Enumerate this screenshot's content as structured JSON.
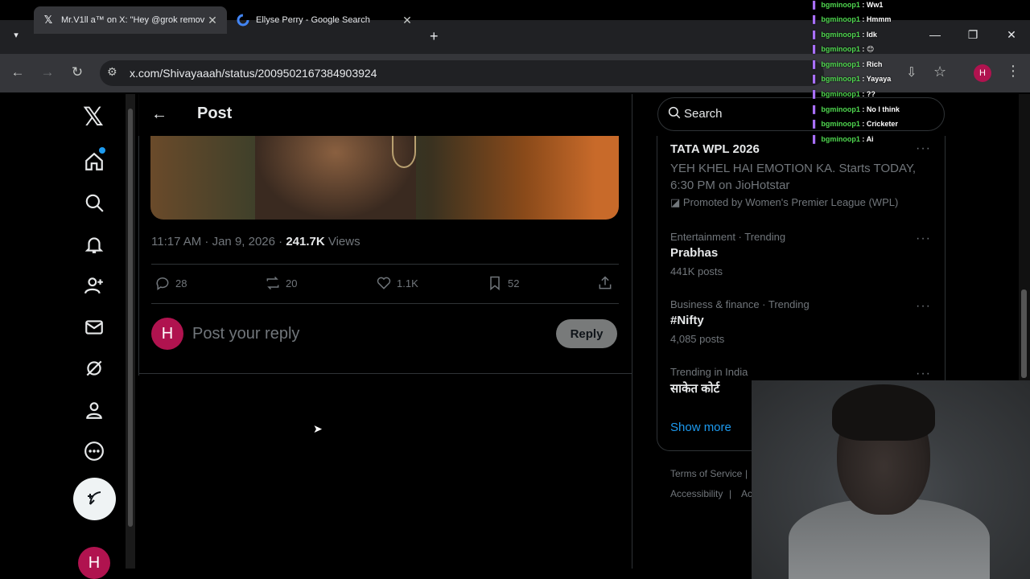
{
  "browser": {
    "tabs": [
      {
        "title": "Mr.V1ll a™ on X: \"Hey @grok remov",
        "favicon": "x-logo",
        "active": true
      },
      {
        "title": "Ellyse Perry - Google Search",
        "favicon": "google-g",
        "active": false
      }
    ],
    "new_tab": "+",
    "url": "x.com/Shivayaaah/status/2009502167384903924",
    "profile_initial": "H"
  },
  "x_nav": {
    "items": [
      "Home",
      "Explore",
      "Notifications",
      "Follow",
      "Messages",
      "Grok",
      "Profile",
      "More"
    ],
    "post_button": "Post",
    "avatar_initial": "H"
  },
  "post": {
    "header_title": "Post",
    "time": "11:17 AM · Jan 9, 2026 · ",
    "views_count": "241.7K",
    "views_label": " Views",
    "actions": {
      "replies": "28",
      "reposts": "20",
      "likes": "1.1K",
      "bookmarks": "52"
    },
    "reply_avatar": "H",
    "reply_placeholder": "Post your reply",
    "reply_button": "Reply"
  },
  "sidebar": {
    "search_placeholder": "Search",
    "promo": {
      "title": "TATA WPL 2026",
      "text": "YEH KHEL HAI EMOTION KA. Starts TODAY, 6:30 PM on JioHotstar",
      "by": "Promoted by Women's Premier League (WPL)"
    },
    "trends": [
      {
        "category": "Entertainment · Trending",
        "title": "Prabhas",
        "count": "441K posts"
      },
      {
        "category": "Business & finance · Trending",
        "title": "#Nifty",
        "count": "4,085 posts"
      },
      {
        "category": "Trending in India",
        "title": "साकेत कोर्ट",
        "count": ""
      }
    ],
    "more_icon": "···",
    "show_more": "Show more",
    "footer": [
      "Terms of Service",
      "|",
      "Accessibility",
      "|",
      "Ac"
    ]
  },
  "chat_overlay": [
    {
      "user": "bgminoop1",
      "message": "Ww1"
    },
    {
      "user": "bgminoop1",
      "message": "Hmmm"
    },
    {
      "user": "bgminoop1",
      "message": "Idk"
    },
    {
      "user": "bgminoop1",
      "message": "😊"
    },
    {
      "user": "bgminoop1",
      "message": "Rich"
    },
    {
      "user": "bgminoop1",
      "message": "Yayaya"
    },
    {
      "user": "bgminoop1",
      "message": "??"
    },
    {
      "user": "bgminoop1",
      "message": "No I think"
    },
    {
      "user": "bgminoop1",
      "message": "Cricketer"
    },
    {
      "user": "bgminoop1",
      "message": "Ai"
    }
  ],
  "colors": {
    "accent": "#1d9bf0",
    "avatar": "#b0134f",
    "bg": "#000000"
  }
}
